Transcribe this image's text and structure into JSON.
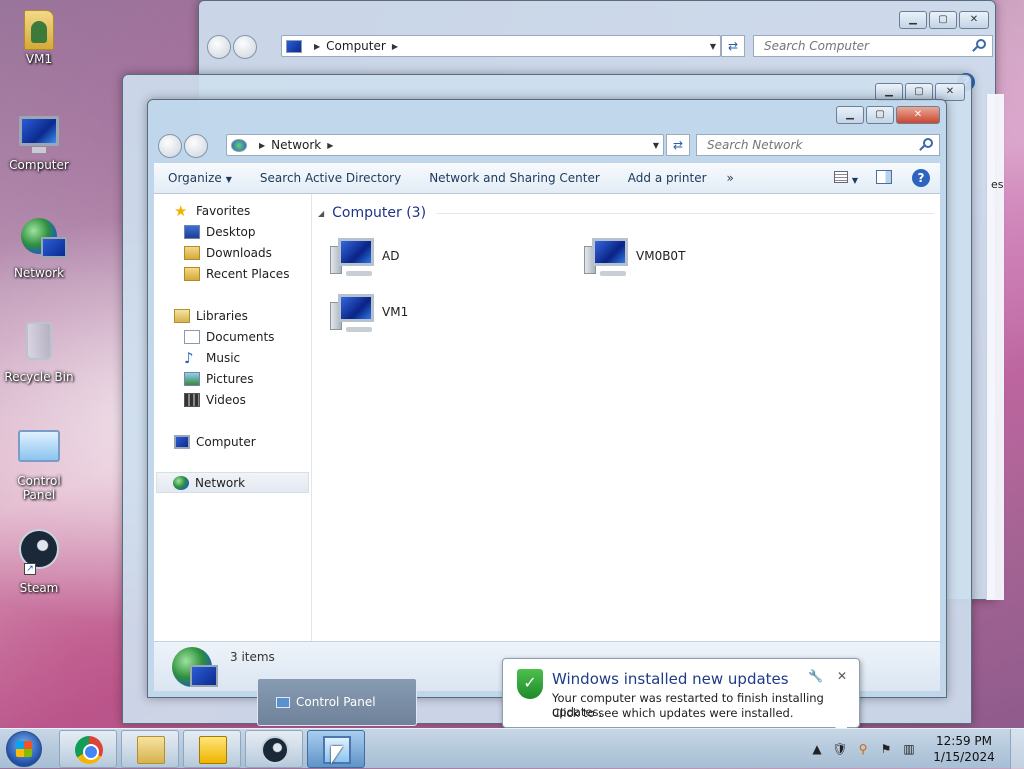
{
  "desktop": {
    "icons": [
      {
        "label": "VM1"
      },
      {
        "label": "Computer"
      },
      {
        "label": "Network"
      },
      {
        "label": "Recycle Bin"
      },
      {
        "label": "Control Panel"
      },
      {
        "label": "Steam"
      }
    ]
  },
  "back_window": {
    "address": "Computer",
    "search_placeholder": "Search Computer",
    "partial_text": "es"
  },
  "window": {
    "address": "Network",
    "search_placeholder": "Search Network",
    "toolbar": {
      "organize": "Organize",
      "search_ad": "Search Active Directory",
      "network_sharing": "Network and Sharing Center",
      "add_printer": "Add a printer",
      "more": "»"
    },
    "nav": {
      "favorites": "Favorites",
      "desktop": "Desktop",
      "downloads": "Downloads",
      "recent": "Recent Places",
      "libraries": "Libraries",
      "documents": "Documents",
      "music": "Music",
      "pictures": "Pictures",
      "videos": "Videos",
      "computer": "Computer",
      "network": "Network"
    },
    "group_header": "Computer (3)",
    "items": [
      "AD",
      "VM0B0T",
      "VM1"
    ],
    "status": "3 items"
  },
  "tooltip": {
    "label": "Control Panel"
  },
  "notification": {
    "title": "Windows installed new updates",
    "line1": "Your computer was restarted to finish installing updates.",
    "line2": "Click to see which updates were installed."
  },
  "taskbar": {
    "clock_time": "12:59 PM",
    "clock_date": "1/15/2024"
  },
  "colors": {
    "accent": "#1e3287",
    "close_button": "#c9462e",
    "taskbar": "#a7bed4"
  }
}
